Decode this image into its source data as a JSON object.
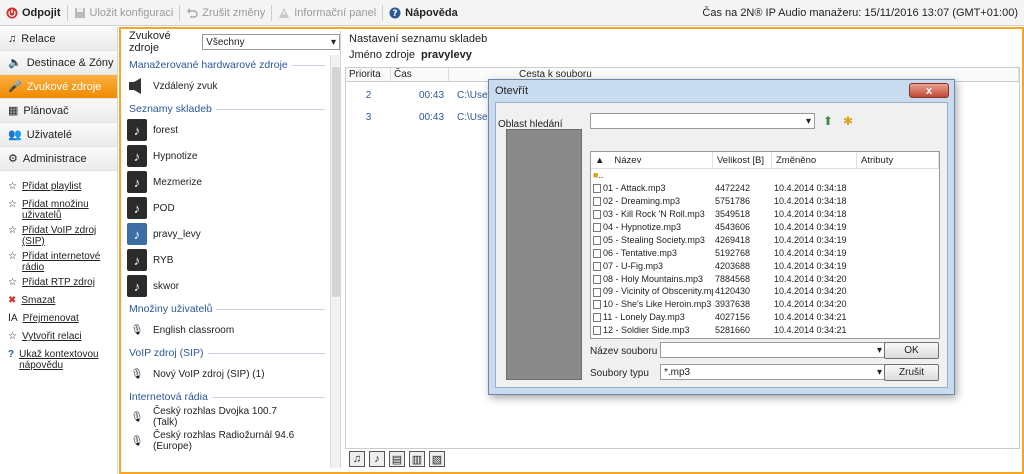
{
  "toolbar": {
    "disconnect": "Odpojit",
    "save_config": "Uložit konfiguraci",
    "undo_changes": "Zrušit změny",
    "info_panel": "Informační panel",
    "help": "Nápověda",
    "time_label": "Čas na 2N® IP Audio manažeru: 15/11/2016 13:07 (GMT+01:00)"
  },
  "nav": {
    "items": [
      {
        "label": "Relace",
        "icon": "note-icon"
      },
      {
        "label": "Destinace & Zóny",
        "icon": "speaker-icon"
      },
      {
        "label": "Zvukové zdroje",
        "icon": "mic-icon"
      },
      {
        "label": "Plánovač",
        "icon": "calendar-icon"
      },
      {
        "label": "Uživatelé",
        "icon": "users-icon"
      },
      {
        "label": "Administrace",
        "icon": "gear-icon"
      }
    ],
    "actions": [
      {
        "label": "Přidat playlist"
      },
      {
        "label": "Přidat množinu uživatelů"
      },
      {
        "label": "Přidat VoIP zdroj (SIP)"
      },
      {
        "label": "Přidat internetové rádio"
      },
      {
        "label": "Přidat RTP zdroj"
      },
      {
        "label": "Smazat"
      },
      {
        "label": "Přejmenovat"
      },
      {
        "label": "Vytvořit relaci"
      },
      {
        "label": "Ukaž kontextovou nápovědu"
      }
    ]
  },
  "sources": {
    "header_label": "Zvukové zdroje",
    "filter_value": "Všechny",
    "categories": {
      "hardware": "Manažerované hardwarové zdroje",
      "playlists": "Seznamy skladeb",
      "user_sets": "Množiny uživatelů",
      "voip": "VoIP zdroj (SIP)",
      "radio": "Internetová rádia"
    },
    "hardware_items": [
      "Vzdálený zvuk"
    ],
    "playlist_items": [
      "forest",
      "Hypnotize",
      "Mezmerize",
      "POD",
      "pravy_levy",
      "RYB",
      "skwor"
    ],
    "user_set_items": [
      "English classroom"
    ],
    "voip_items": [
      "Nový VoIP zdroj (SIP) (1)"
    ],
    "radio_items": [
      "Český rozhlas Dvojka 100.7 (Talk)",
      "Český rozhlas Radiožurnál 94.6 (Europe)"
    ]
  },
  "playlist_settings": {
    "title": "Nastavení seznamu skladeb",
    "name_label": "Jméno zdroje",
    "name_value": "pravylevy",
    "columns": [
      "Priorita",
      "Čas",
      "Cesta k souboru"
    ],
    "rows": [
      {
        "priority": "2",
        "time": "00:43",
        "path": "C:\\Users\\"
      },
      {
        "priority": "3",
        "time": "00:43",
        "path": "C:\\Users\\"
      }
    ]
  },
  "dialog": {
    "title": "Otevřít",
    "close": "x",
    "look_in_label": "Oblast hledání",
    "look_in_value": "",
    "columns": [
      "Název",
      "Velikost [B]",
      "Změněno",
      "Atributy"
    ],
    "parent": "..",
    "files": [
      {
        "name": "01 - Attack.mp3",
        "size": "4472242",
        "modified": "10.4.2014 0:34:18"
      },
      {
        "name": "02 - Dreaming.mp3",
        "size": "5751786",
        "modified": "10.4.2014 0:34:18"
      },
      {
        "name": "03 - Kill Rock 'N Roll.mp3",
        "size": "3549518",
        "modified": "10.4.2014 0:34:18"
      },
      {
        "name": "04 - Hypnotize.mp3",
        "size": "4543606",
        "modified": "10.4.2014 0:34:19"
      },
      {
        "name": "05 - Stealing Society.mp3",
        "size": "4269418",
        "modified": "10.4.2014 0:34:19"
      },
      {
        "name": "06 - Tentative.mp3",
        "size": "5192768",
        "modified": "10.4.2014 0:34:19"
      },
      {
        "name": "07 - U-Fig.mp3",
        "size": "4203688",
        "modified": "10.4.2014 0:34:19"
      },
      {
        "name": "08 - Holy Mountains.mp3",
        "size": "7884568",
        "modified": "10.4.2014 0:34:20"
      },
      {
        "name": "09 - Vicinity of Obscenity.mp3",
        "size": "4120430",
        "modified": "10.4.2014 0:34:20"
      },
      {
        "name": "10 - She's Like Heroin.mp3",
        "size": "3937638",
        "modified": "10.4.2014 0:34:20"
      },
      {
        "name": "11 - Lonely Day.mp3",
        "size": "4027156",
        "modified": "10.4.2014 0:34:21"
      },
      {
        "name": "12 - Soldier Side.mp3",
        "size": "5281660",
        "modified": "10.4.2014 0:34:21"
      }
    ],
    "filename_label": "Název souboru",
    "filename_value": "",
    "filetype_label": "Soubory typu",
    "filetype_value": "*.mp3",
    "ok_label": "OK",
    "cancel_label": "Zrušit"
  },
  "colors": {
    "accent": "#f5a623",
    "link_blue": "#2b5797"
  }
}
